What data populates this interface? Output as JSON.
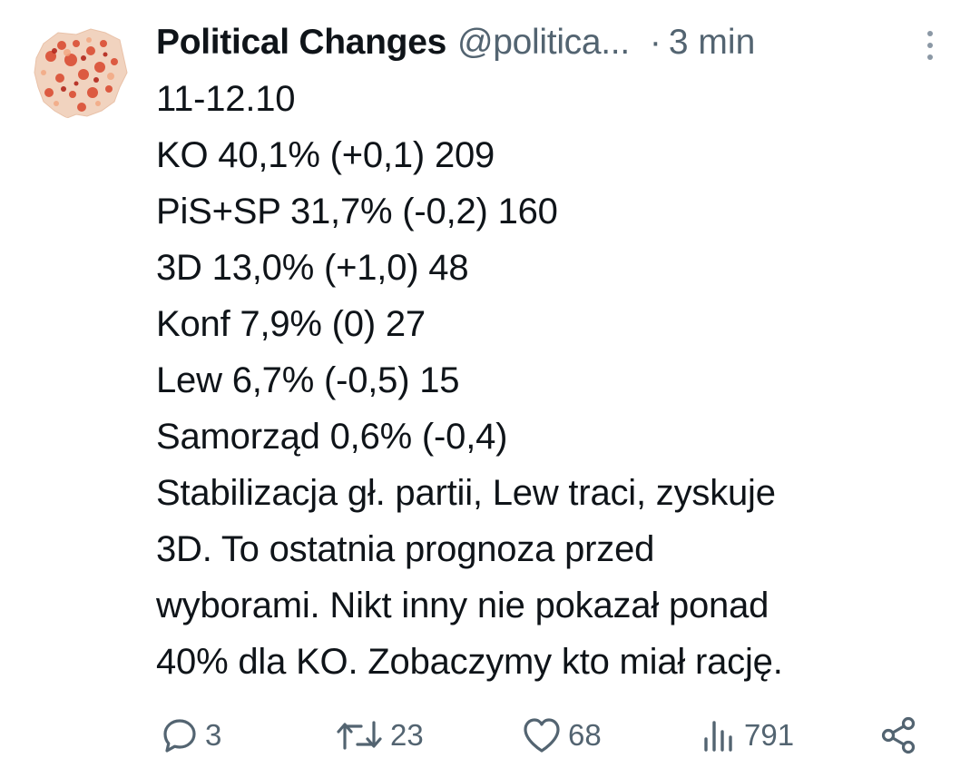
{
  "tweet": {
    "author": {
      "display_name": "Political Changes",
      "handle": "@politica...",
      "avatar_icon": "map-of-poland-avatar"
    },
    "separator": "·",
    "timestamp": "3 min",
    "lines": [
      "11-12.10",
      "KO 40,1% (+0,1) 209",
      "PiS+SP 31,7% (-0,2) 160",
      "3D 13,0% (+1,0) 48",
      "Konf 7,9% (0) 27",
      "Lew 6,7% (-0,5) 15",
      "Samorząd 0,6% (-0,4)",
      "Stabilizacja gł. partii, Lew traci, zyskuje",
      "3D. To ostatnia prognoza przed",
      "wyborami. Nikt inny nie pokazał ponad",
      "40% dla KO. Zobaczymy kto miał rację."
    ],
    "actions": {
      "reply_count": "3",
      "retweet_count": "23",
      "like_count": "68",
      "views_count": "791"
    }
  },
  "colors": {
    "text_primary": "#0f1419",
    "text_secondary": "#536471",
    "background": "#ffffff"
  },
  "icons": {
    "more": "more-vertical-icon",
    "reply": "reply-icon",
    "retweet": "retweet-icon",
    "like": "heart-icon",
    "views": "views-chart-icon",
    "share": "share-icon"
  }
}
